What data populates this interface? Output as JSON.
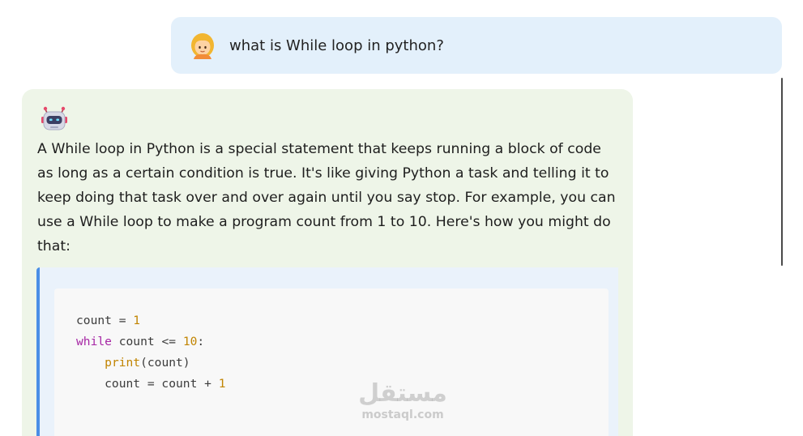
{
  "chat": {
    "user_message": "what is While loop in python?",
    "user_avatar_icon": "girl-emoji-icon",
    "bot_avatar_icon": "robot-emoji-icon",
    "bot_message": "A While loop in Python is a special statement that keeps running a block of code as long as a certain condition is true. It's like giving Python a task and telling it to keep doing that task over and over again until you say stop. For example, you can use a While loop to make a program count from 1 to 10. Here's how you might do that:",
    "code_lines": [
      [
        {
          "t": "count = ",
          "c": "plain"
        },
        {
          "t": "1",
          "c": "num"
        }
      ],
      [
        {
          "t": "while",
          "c": "kw"
        },
        {
          "t": " count <= ",
          "c": "plain"
        },
        {
          "t": "10",
          "c": "num"
        },
        {
          "t": ":",
          "c": "plain"
        }
      ],
      [
        {
          "t": "    ",
          "c": "plain"
        },
        {
          "t": "print",
          "c": "fn"
        },
        {
          "t": "(count)",
          "c": "plain"
        }
      ],
      [
        {
          "t": "    count = count + ",
          "c": "plain"
        },
        {
          "t": "1",
          "c": "num"
        }
      ]
    ]
  },
  "watermark": {
    "arabic": "مستقل",
    "latin": "mostaql.com"
  },
  "colors": {
    "user_bubble": "#e3f0fb",
    "bot_bubble": "#eef5e8",
    "code_accent": "#4a8ee6",
    "keyword": "#a626a4",
    "number": "#c18401"
  }
}
